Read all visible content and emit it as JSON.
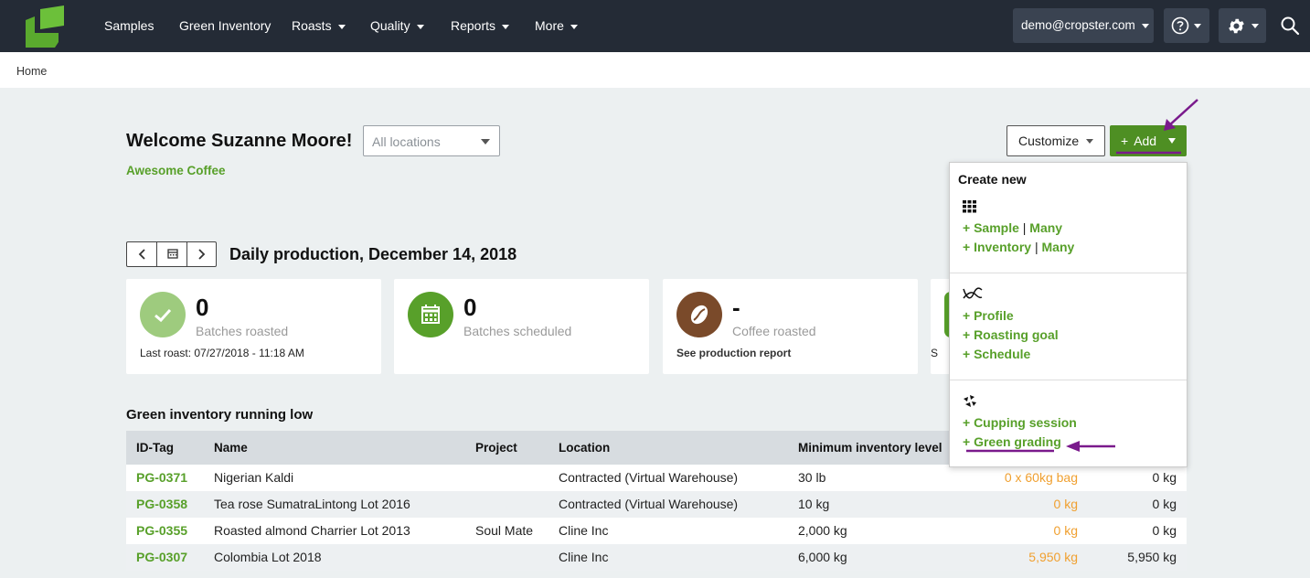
{
  "nav": {
    "items": [
      {
        "label": "Samples",
        "caret": false
      },
      {
        "label": "Green Inventory",
        "caret": false
      },
      {
        "label": "Roasts",
        "caret": true
      },
      {
        "label": "Quality",
        "caret": true
      },
      {
        "label": "Reports",
        "caret": true
      },
      {
        "label": "More",
        "caret": true
      }
    ],
    "user_email": "demo@cropster.com",
    "help_icon": "help-circle-icon",
    "settings_icon": "gear-icon",
    "search_icon": "search-icon"
  },
  "breadcrumb": "Home",
  "header": {
    "welcome": "Welcome Suzanne Moore!",
    "company": "Awesome Coffee",
    "location_placeholder": "All locations",
    "customize_label": "Customize",
    "add_label": "Add"
  },
  "daily": {
    "title": "Daily production, December 14, 2018"
  },
  "cards": [
    {
      "value": "0",
      "label": "Batches roasted",
      "footer": "Last roast: 07/27/2018 - 11:18 AM",
      "icon": "check-icon",
      "color": "#9ecb7e"
    },
    {
      "value": "0",
      "label": "Batches scheduled",
      "footer": "",
      "icon": "calendar-icon",
      "color": "#58a02a"
    },
    {
      "value": "-",
      "label": "Coffee roasted",
      "footer": "See production report",
      "icon": "coffee-bean-icon",
      "color": "#7a4a2a"
    },
    {
      "value": "",
      "label": "",
      "footer": "S",
      "icon": "",
      "color": "#58a02a"
    }
  ],
  "inventory": {
    "title": "Green inventory running low",
    "columns": [
      "ID-Tag",
      "Name",
      "Project",
      "Location",
      "Minimum inventory level"
    ],
    "rows": [
      {
        "id": "PG-0371",
        "name": "Nigerian Kaldi",
        "project": "",
        "location": "Contracted (Virtual Warehouse)",
        "min": "30 lb",
        "avail": "0 x 60kg bag",
        "total": "0 kg"
      },
      {
        "id": "PG-0358",
        "name": "Tea rose SumatraLintong Lot 2016",
        "project": "",
        "location": "Contracted (Virtual Warehouse)",
        "min": "10 kg",
        "avail": "0 kg",
        "total": "0 kg"
      },
      {
        "id": "PG-0355",
        "name": "Roasted almond Charrier Lot 2013",
        "project": "Soul Mate",
        "location": "Cline Inc",
        "min": "2,000 kg",
        "avail": "0 kg",
        "total": "0 kg"
      },
      {
        "id": "PG-0307",
        "name": "Colombia Lot 2018",
        "project": "",
        "location": "Cline Inc",
        "min": "6,000 kg",
        "avail": "5,950 kg",
        "total": "5,950 kg"
      }
    ]
  },
  "dropdown": {
    "heading": "Create new",
    "groups": [
      {
        "icon": "grid-icon",
        "links": [
          {
            "label": "+ Sample",
            "extra": "Many"
          },
          {
            "label": "+ Inventory",
            "extra": "Many"
          }
        ]
      },
      {
        "icon": "roast-curve-icon",
        "links": [
          {
            "label": "+ Profile"
          },
          {
            "label": "+ Roasting goal"
          },
          {
            "label": "+ Schedule"
          }
        ]
      },
      {
        "icon": "cupping-icon",
        "links": [
          {
            "label": "+ Cupping session"
          },
          {
            "label": "+ Green grading"
          }
        ]
      }
    ],
    "pipe": "|"
  },
  "colors": {
    "navbar": "#242b36",
    "brand_green": "#58a02a",
    "add_button": "#4e8f23",
    "warning_orange": "#f0a030",
    "annotation_purple": "#7a1a8c"
  }
}
